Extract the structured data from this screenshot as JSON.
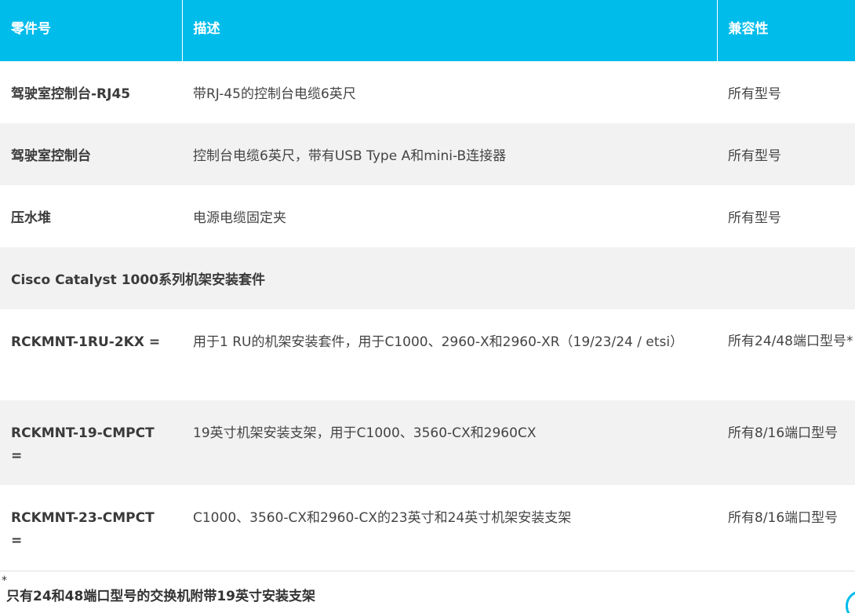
{
  "table": {
    "headers": {
      "part": "零件号",
      "description": "描述",
      "compatibility": "兼容性"
    },
    "rows": [
      {
        "part": "驾驶室控制台-RJ45",
        "description": "带RJ-45的控制台电缆6英尺",
        "compatibility": "所有型号"
      },
      {
        "part": "驾驶室控制台",
        "description": "控制台电缆6英尺，带有USB Type A和mini-B连接器",
        "compatibility": "所有型号"
      },
      {
        "part": "压水堆",
        "description": "电源电缆固定夹",
        "compatibility": "所有型号"
      }
    ],
    "section_title": "Cisco Catalyst 1000系列机架安装套件",
    "rack_rows": [
      {
        "part": "RCKMNT-1RU-2KX =",
        "description": "用于1 RU的机架安装套件，用于C1000、2960-X和2960-XR（19/23/24 / etsi）",
        "compatibility": "所有24/48端口型号*"
      },
      {
        "part": "RCKMNT-19-CMPCT =",
        "description": "19英寸机架安装支架，用于C1000、3560-CX和2960CX",
        "compatibility": "所有8/16端口型号"
      },
      {
        "part": "RCKMNT-23-CMPCT =",
        "description": "C1000、3560-CX和2960-CX的23英寸和24英寸机架安装支架",
        "compatibility": "所有8/16端口型号"
      }
    ]
  },
  "footnote": {
    "marker": "*",
    "text": "只有24和48端口型号的交换机附带19英寸安装支架"
  },
  "colors": {
    "header_bg": "#00bceb",
    "stripe_bg": "#f2f2f2"
  }
}
